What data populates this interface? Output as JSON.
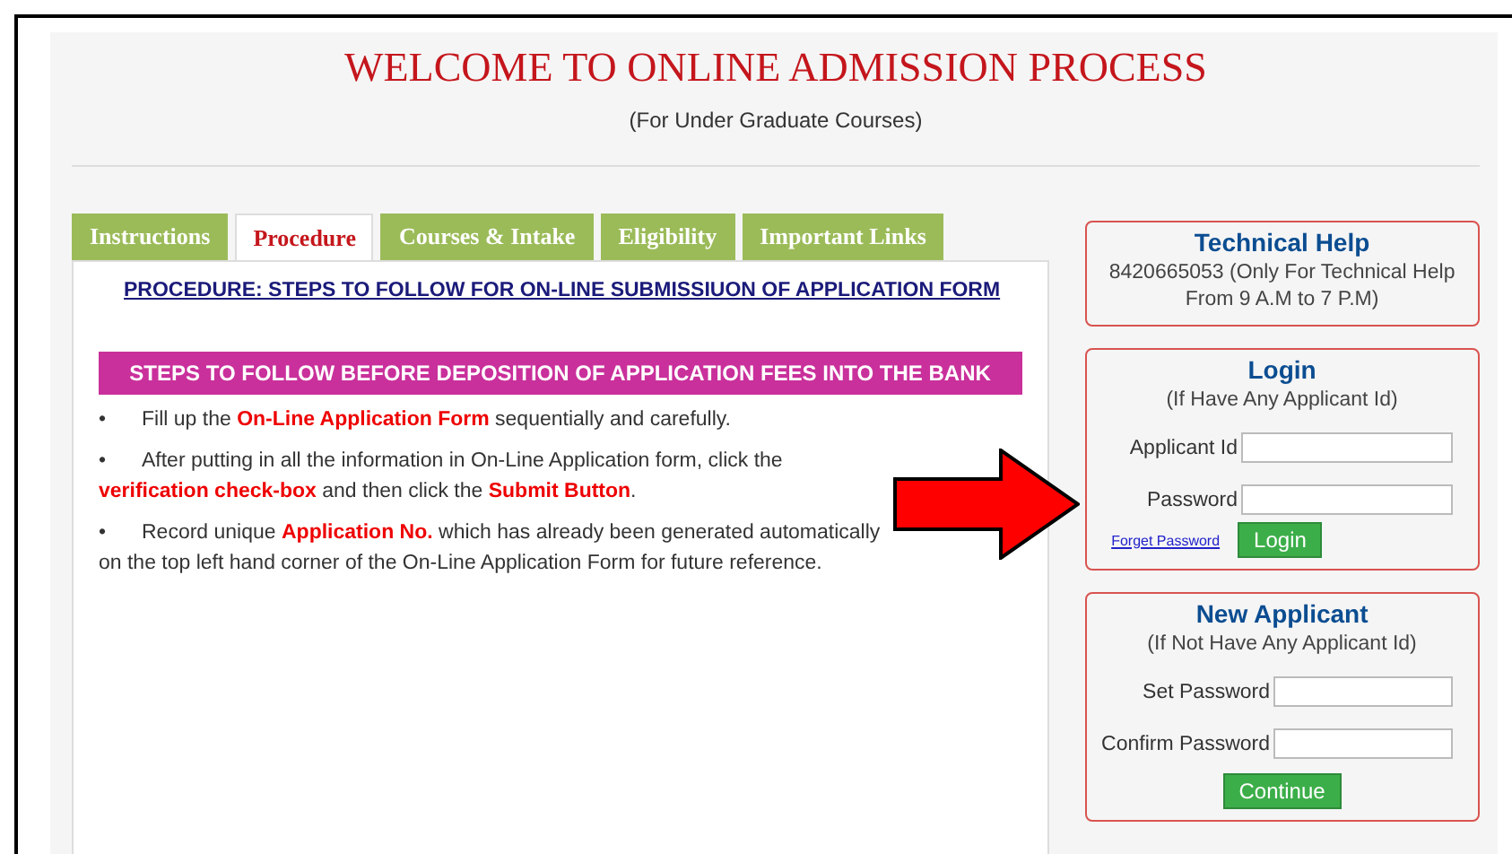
{
  "header": {
    "title": "WELCOME TO ONLINE ADMISSION PROCESS",
    "subtitle": "(For Under Graduate Courses)"
  },
  "tabs": [
    {
      "label": "Instructions",
      "selected": false
    },
    {
      "label": "Procedure",
      "selected": true
    },
    {
      "label": "Courses & Intake",
      "selected": false
    },
    {
      "label": "Eligibility",
      "selected": false
    },
    {
      "label": "Important Links",
      "selected": false
    }
  ],
  "procedure": {
    "heading": "PROCEDURE: STEPS TO FOLLOW FOR ON-LINE SUBMISSIUON OF APPLICATION FORM",
    "banner": "STEPS TO FOLLOW BEFORE DEPOSITION OF APPLICATION FEES INTO THE BANK",
    "steps": [
      {
        "bullet": "•",
        "text": "Fill up the **On-Line Application Form** sequentially and carefully."
      },
      {
        "bullet": "•",
        "text": "After putting in all the information in On-Line Application form, click the **verification check-box** and then click the **Submit Button**."
      },
      {
        "bullet": "•",
        "text": "Record unique **Application No.** which has already been generated automatically on the top left hand corner of the On-Line Application Form for future reference."
      }
    ]
  },
  "technical_help": {
    "title": "Technical Help",
    "text": "8420665053 (Only For Technical Help From 9 A.M to 7 P.M)"
  },
  "login": {
    "title": "Login",
    "subtitle": "(If Have Any Applicant Id)",
    "fields": [
      {
        "label": "Applicant Id"
      },
      {
        "label": "Password"
      }
    ],
    "link": "Forget Password",
    "button": "Login"
  },
  "new_applicant": {
    "title": "New Applicant",
    "subtitle": "(If Not Have Any Applicant Id)",
    "fields": [
      {
        "label": "Set Password"
      },
      {
        "label": "Confirm Password"
      }
    ],
    "button": "Continue"
  }
}
